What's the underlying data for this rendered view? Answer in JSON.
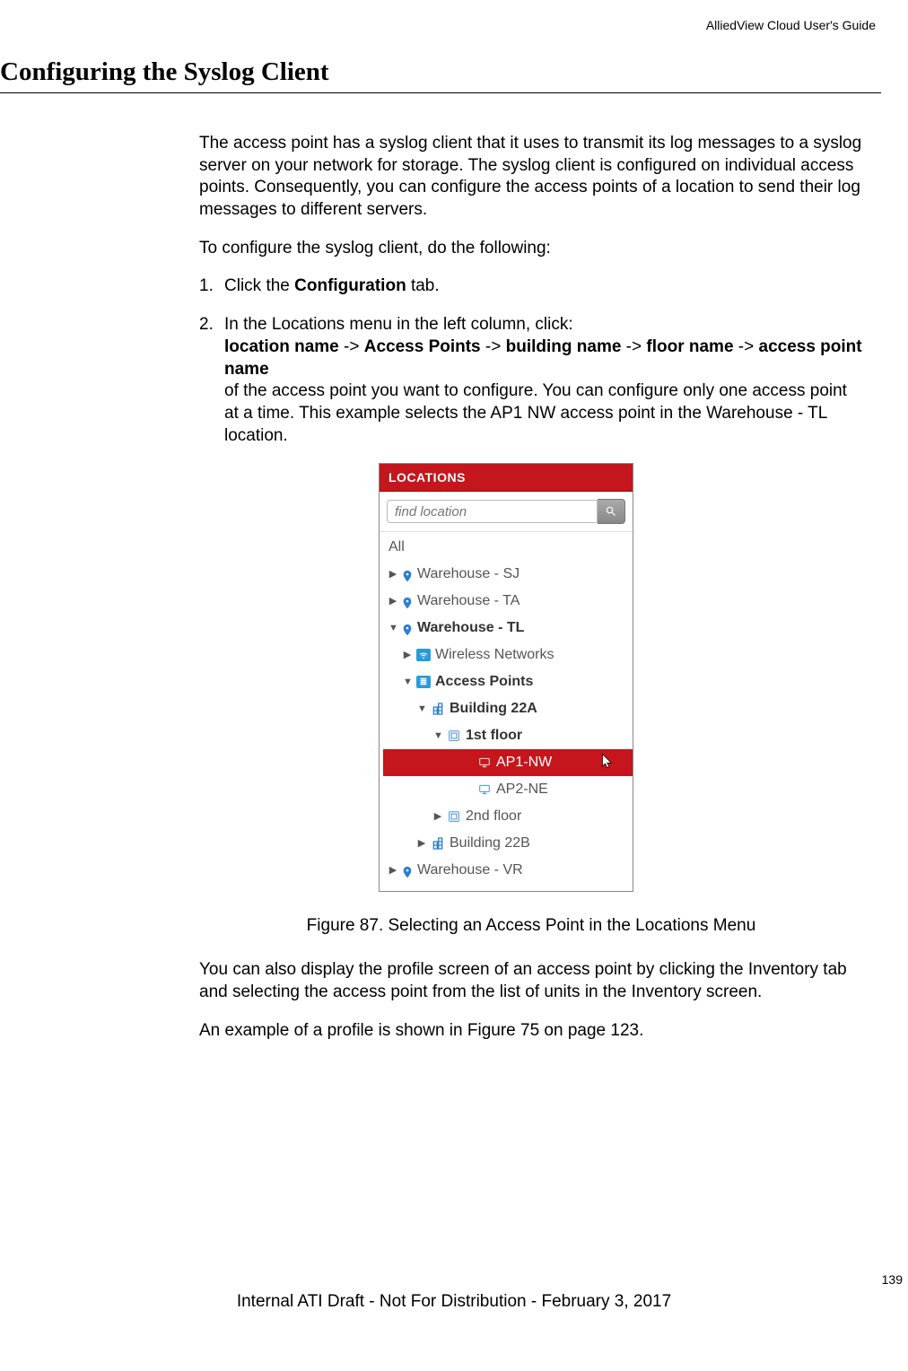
{
  "header": {
    "doc_title": "AlliedView Cloud User's Guide"
  },
  "section": {
    "title": "Configuring the Syslog Client"
  },
  "intro": "The access point has a syslog client that it uses to transmit its log messages to a syslog server on your network for storage. The syslog client is configured on individual access points. Consequently, you can configure the access points of a location to send their log messages to different servers.",
  "lead": "To configure the syslog client, do the following:",
  "steps": {
    "s1": {
      "num": "1.",
      "pre": "Click the ",
      "bold": "Configuration",
      "post": " tab."
    },
    "s2": {
      "num": "2.",
      "line1": "In the Locations menu in the left column, click:",
      "path_b1": "location name",
      "sep": " -> ",
      "path_b2": "Access Points",
      "path_b3": "building name",
      "path_b4": "floor name",
      "path_b5": "access point name",
      "line2": "of the access point you want to configure. You can configure only one access point at a time. This example selects the AP1 NW access point in the Warehouse - TL location."
    }
  },
  "locations": {
    "header": "LOCATIONS",
    "search_placeholder": "find location",
    "all": "All",
    "items": {
      "wh_sj": "Warehouse - SJ",
      "wh_ta": "Warehouse - TA",
      "wh_tl": "Warehouse - TL",
      "wn": "Wireless Networks",
      "ap": "Access Points",
      "b22a": "Building 22A",
      "f1": "1st floor",
      "ap1": "AP1-NW",
      "ap2": "AP2-NE",
      "f2": "2nd floor",
      "b22b": "Building 22B",
      "wh_vr": "Warehouse - VR"
    }
  },
  "figure": {
    "caption": "Figure 87. Selecting an Access Point in the Locations Menu"
  },
  "after1": "You can also display the profile screen of an access point by clicking the Inventory tab and selecting the access point from the list of units in the Inventory screen.",
  "after2": "An example of a profile is shown in Figure 75 on page 123.",
  "footer": {
    "page": "139",
    "note": "Internal ATI Draft - Not For Distribution - February 3, 2017"
  }
}
